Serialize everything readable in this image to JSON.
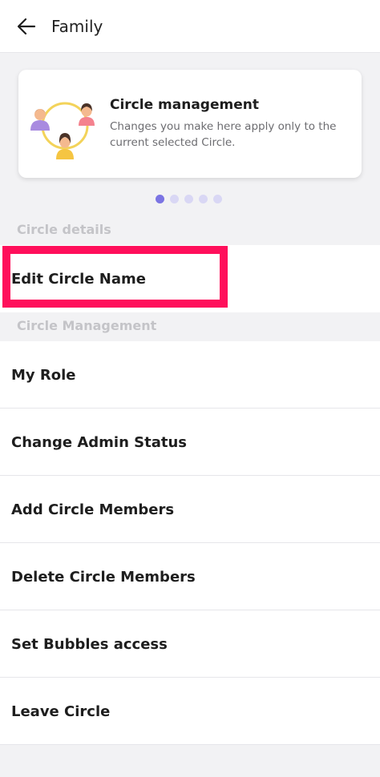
{
  "header": {
    "title": "Family",
    "back_icon": "arrow-left-icon"
  },
  "info_card": {
    "illustration_icon": "circle-members-icon",
    "title": "Circle management",
    "description": "Changes you make here apply only to the current selected Circle.",
    "pager": {
      "total": 5,
      "current": 1
    }
  },
  "sections": [
    {
      "label": "Circle details",
      "items": [
        {
          "label": "Edit Circle Name"
        }
      ]
    },
    {
      "label": "Circle Management",
      "items": [
        {
          "label": "My Role"
        },
        {
          "label": "Change Admin Status"
        },
        {
          "label": "Add Circle Members"
        },
        {
          "label": "Delete Circle Members"
        },
        {
          "label": "Set Bubbles access"
        },
        {
          "label": "Leave Circle"
        }
      ]
    }
  ],
  "colors": {
    "highlight": "#ff0f5b",
    "pager_active": "#7b74e3",
    "pager_inactive": "#d9d7f4",
    "page_background": "#f2f2f4"
  }
}
